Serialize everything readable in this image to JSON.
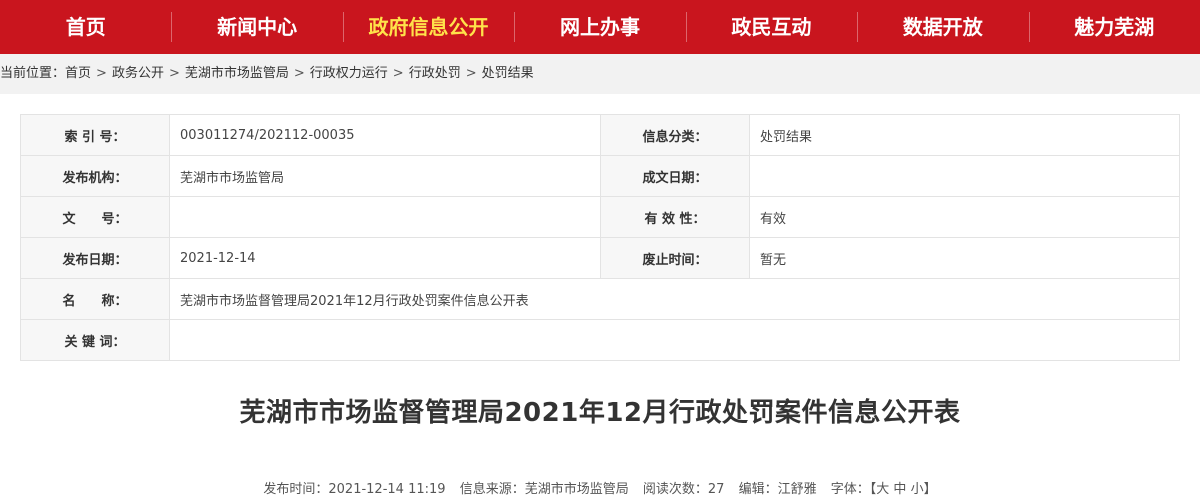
{
  "nav": {
    "items": [
      {
        "label": "首页",
        "active": false
      },
      {
        "label": "新闻中心",
        "active": false
      },
      {
        "label": "政府信息公开",
        "active": true
      },
      {
        "label": "网上办事",
        "active": false
      },
      {
        "label": "政民互动",
        "active": false
      },
      {
        "label": "数据开放",
        "active": false
      },
      {
        "label": "魅力芜湖",
        "active": false
      }
    ],
    "bg_color": "#c9151e",
    "active_color": "#ffe24a"
  },
  "breadcrumb": {
    "prefix": "当前位置：",
    "items": [
      "首页",
      "政务公开",
      "芜湖市市场监管局",
      "行政权力运行",
      "行政处罚",
      "处罚结果"
    ],
    "separator": ">"
  },
  "info": {
    "index_label": "索 引 号：",
    "index_value": "003011274/202112-00035",
    "category_label": "信息分类：",
    "category_value": "处罚结果",
    "publisher_label": "发布机构：",
    "publisher_value": "芜湖市市场监管局",
    "written_date_label": "成文日期：",
    "written_date_value": "",
    "doc_no_label": "文　　号：",
    "doc_no_value": "",
    "validity_label": "有 效 性：",
    "validity_value": "有效",
    "publish_date_label": "发布日期：",
    "publish_date_value": "2021-12-14",
    "expiry_label": "废止时间：",
    "expiry_value": "暂无",
    "name_label": "名　　称：",
    "name_value": "芜湖市市场监督管理局2021年12月行政处罚案件信息公开表",
    "keywords_label": "关 键 词：",
    "keywords_value": ""
  },
  "article": {
    "title": "芜湖市市场监督管理局2021年12月行政处罚案件信息公开表",
    "meta": {
      "publish_time_label": "发布时间：",
      "publish_time": "2021-12-14 11:19",
      "source_label": "信息来源：",
      "source": "芜湖市市场监管局",
      "views_label": "阅读次数：",
      "views": "27",
      "editor_label": "编辑：",
      "editor": "江舒雅",
      "font_label": "字体：",
      "bracket_open": "【",
      "font_large": "大",
      "font_medium": "中",
      "font_small": "小",
      "bracket_close": "】"
    }
  }
}
